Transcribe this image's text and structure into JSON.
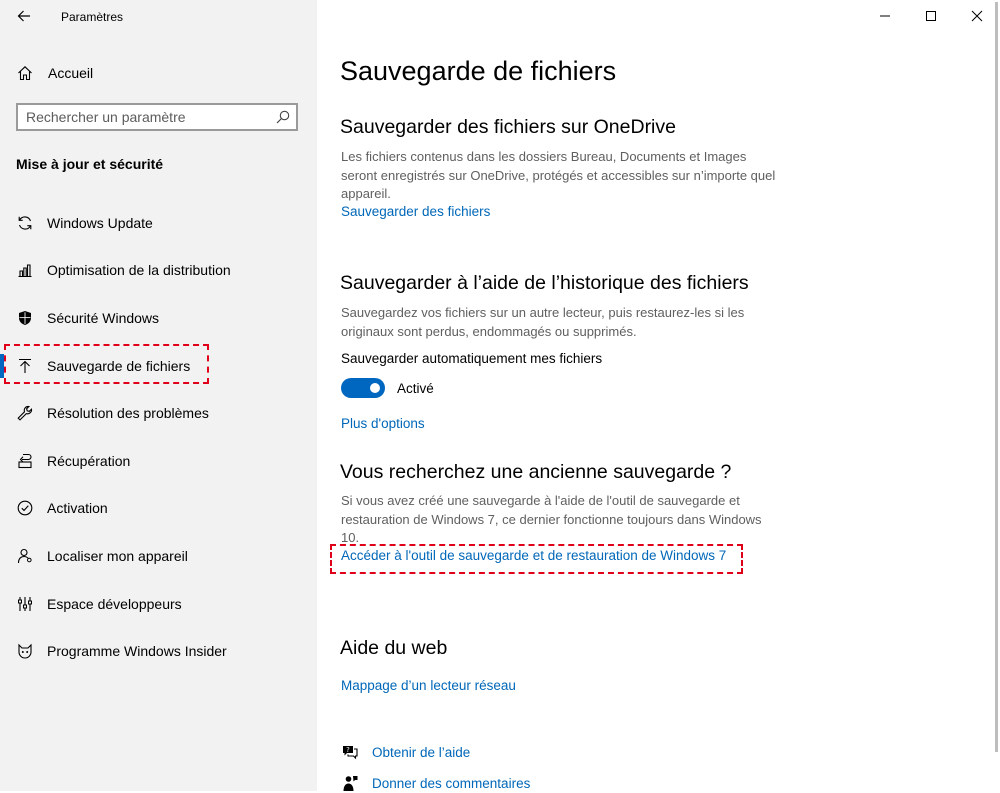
{
  "window": {
    "app_title": "Paramètres",
    "controls": [
      "minimize",
      "maximize",
      "close"
    ]
  },
  "sidebar": {
    "home_label": "Accueil",
    "search_placeholder": "Rechercher un paramètre",
    "search_value": "",
    "section_title": "Mise à jour et sécurité",
    "items": [
      {
        "label": "Windows Update",
        "icon": "sync-icon"
      },
      {
        "label": "Optimisation de la distribution",
        "icon": "delivery-optimization-icon"
      },
      {
        "label": "Sécurité Windows",
        "icon": "shield-icon"
      },
      {
        "label": "Sauvegarde de fichiers",
        "icon": "upload-arrow-icon",
        "selected": true
      },
      {
        "label": "Résolution des problèmes",
        "icon": "wrench-icon"
      },
      {
        "label": "Récupération",
        "icon": "recovery-icon"
      },
      {
        "label": "Activation",
        "icon": "check-circle-icon"
      },
      {
        "label": "Localiser mon appareil",
        "icon": "person-locate-icon"
      },
      {
        "label": "Espace développeurs",
        "icon": "developer-icon"
      },
      {
        "label": "Programme Windows Insider",
        "icon": "insider-cat-icon"
      }
    ]
  },
  "main": {
    "page_title": "Sauvegarde de fichiers",
    "onedrive": {
      "heading": "Sauvegarder des fichiers sur OneDrive",
      "description": "Les fichiers contenus dans les dossiers Bureau, Documents et Images seront enregistrés sur OneDrive, protégés et accessibles sur n’importe quel appareil.",
      "link": "Sauvegarder des fichiers"
    },
    "history": {
      "heading": "Sauvegarder à l’aide de l’historique des fichiers",
      "description": "Sauvegardez vos fichiers sur un autre lecteur, puis restaurez-les si les originaux sont perdus, endommagés ou supprimés.",
      "toggle_label": "Sauvegarder automatiquement mes fichiers",
      "toggle_state": "Activé",
      "toggle_on": true,
      "more_link": "Plus d'options"
    },
    "old_backup": {
      "heading": "Vous recherchez une ancienne sauvegarde ?",
      "description": "Si vous avez créé une sauvegarde à l'aide de l'outil de sauvegarde et restauration de Windows 7, ce dernier fonctionne toujours dans Windows 10.",
      "link": "Accéder à l'outil de sauvegarde et de restauration de Windows 7"
    },
    "web_help": {
      "heading": "Aide du web",
      "link": "Mappage d’un lecteur réseau"
    },
    "help_links": [
      {
        "label": "Obtenir de l’aide",
        "icon": "help-chat-icon"
      },
      {
        "label": "Donner des commentaires",
        "icon": "feedback-icon"
      }
    ]
  },
  "colors": {
    "accent": "#0067c0",
    "link": "#0067b8",
    "sidebar_bg": "#f2f2f2",
    "highlight_dash": "#e0001a"
  }
}
